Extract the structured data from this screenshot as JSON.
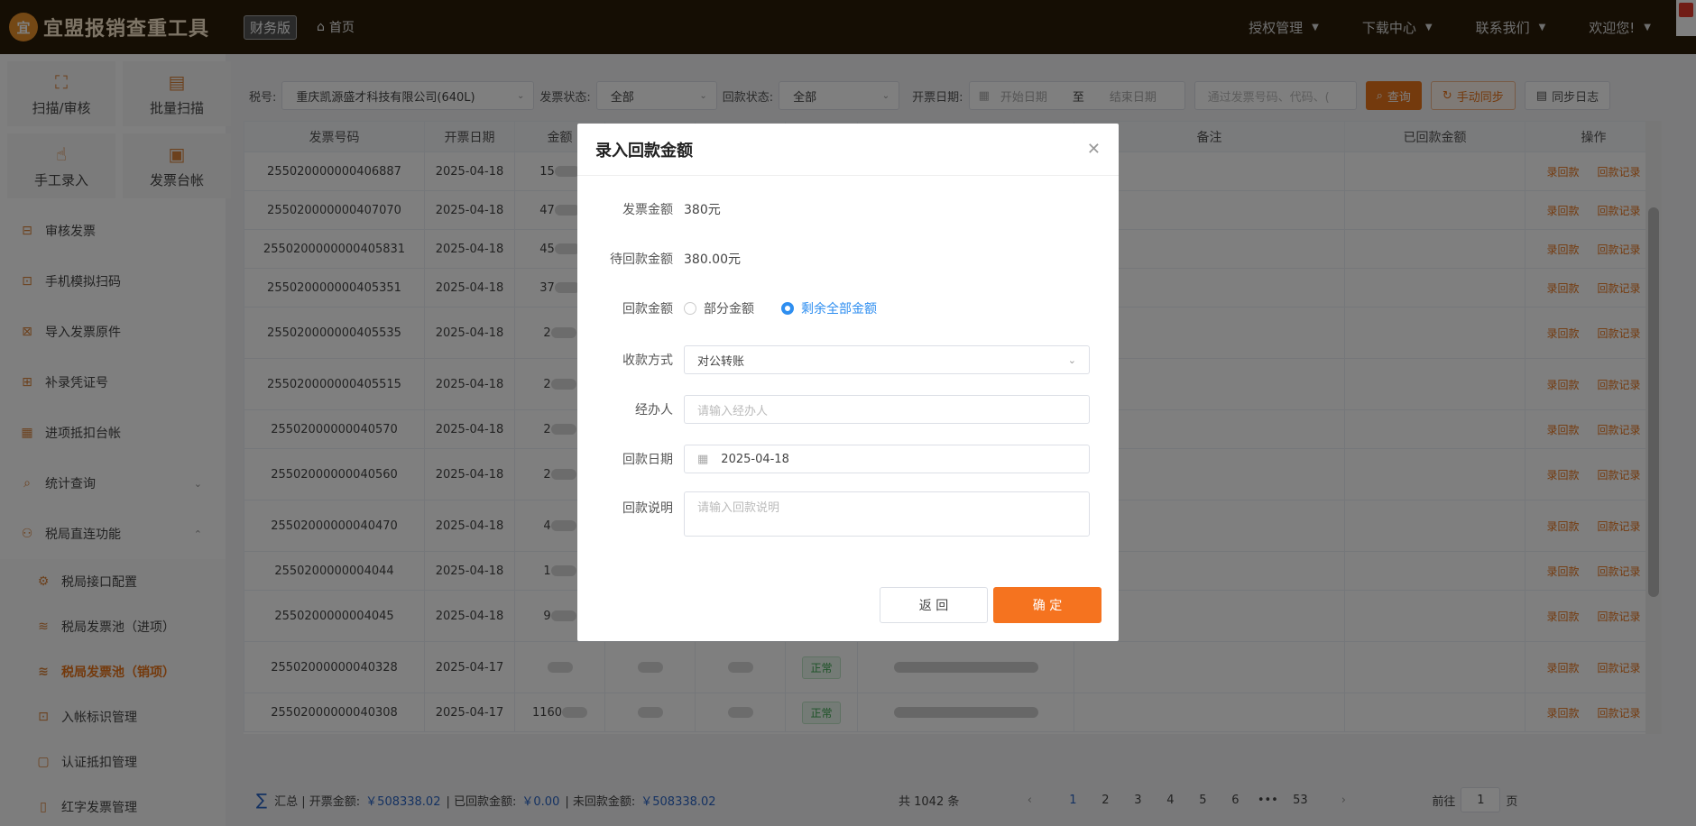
{
  "topbar": {
    "logo_mark": "宜",
    "app_title": "宜盟报销查重工具",
    "edition": "财务版",
    "home": "首页",
    "menus": [
      "授权管理",
      "下载中心",
      "联系我们",
      "欢迎您!"
    ]
  },
  "sidebar": {
    "quick": [
      {
        "label": "扫描/审核",
        "icon": "scan-icon"
      },
      {
        "label": "批量扫描",
        "icon": "batch-scan-icon"
      },
      {
        "label": "手工录入",
        "icon": "hand-entry-icon"
      },
      {
        "label": "发票台帐",
        "icon": "ledger-icon"
      }
    ],
    "items": [
      {
        "label": "审核发票"
      },
      {
        "label": "手机模拟扫码"
      },
      {
        "label": "导入发票原件"
      },
      {
        "label": "补录凭证号"
      },
      {
        "label": "进项抵扣台帐"
      },
      {
        "label": "统计查询"
      },
      {
        "label": "税局直连功能"
      }
    ],
    "sub_items": [
      {
        "label": "税局接口配置"
      },
      {
        "label": "税局发票池（进项）"
      },
      {
        "label": "税局发票池（销项）"
      },
      {
        "label": "入帐标识管理"
      },
      {
        "label": "认证抵扣管理"
      },
      {
        "label": "红字发票管理"
      }
    ]
  },
  "filters": {
    "tax_label": "税号:",
    "tax_value": "重庆凯源盛才科技有限公司(640L)",
    "invoice_status_label": "发票状态:",
    "invoice_status_value": "全部",
    "payback_status_label": "回款状态:",
    "payback_status_value": "全部",
    "date_label": "开票日期:",
    "start_placeholder": "开始日期",
    "to": "至",
    "end_placeholder": "结束日期",
    "search_placeholder": "通过发票号码、代码、(",
    "query_btn": "查询",
    "sync_btn": "手动同步",
    "log_btn": "同步日志"
  },
  "table": {
    "headers": [
      "发票号码",
      "开票日期",
      "金额",
      "",
      "",
      "",
      "",
      "备注",
      "已回款金额",
      "操作"
    ],
    "rows": [
      {
        "no": "255020000000406887",
        "date": "2025-04-18",
        "amount": "15",
        "status": ""
      },
      {
        "no": "255020000000407070",
        "date": "2025-04-18",
        "amount": "47",
        "status": ""
      },
      {
        "no": "2550200000000405831",
        "date": "2025-04-18",
        "amount": "45",
        "status": ""
      },
      {
        "no": "255020000000405351",
        "date": "2025-04-18",
        "amount": "37",
        "status": ""
      },
      {
        "no": "255020000000405535",
        "date": "2025-04-18",
        "amount": "2",
        "status": ""
      },
      {
        "no": "255020000000405515",
        "date": "2025-04-18",
        "amount": "2",
        "status": ""
      },
      {
        "no": "25502000000040570",
        "date": "2025-04-18",
        "amount": "2",
        "status": ""
      },
      {
        "no": "25502000000040560",
        "date": "2025-04-18",
        "amount": "2",
        "status": ""
      },
      {
        "no": "25502000000040470",
        "date": "2025-04-18",
        "amount": "4",
        "status": ""
      },
      {
        "no": "2550200000004044",
        "date": "2025-04-18",
        "amount": "1",
        "status": ""
      },
      {
        "no": "2550200000004045",
        "date": "2025-04-18",
        "amount": "9",
        "status": ""
      },
      {
        "no": "25502000000040328",
        "date": "2025-04-17",
        "amount": "",
        "status": "正常"
      },
      {
        "no": "25502000000040308",
        "date": "2025-04-17",
        "amount": "1160",
        "status": "正常"
      }
    ],
    "op_payback": "录回款",
    "op_record": "回款记录"
  },
  "footer": {
    "summary_prefix": "汇总 | 开票金额:",
    "invoice_total": "￥508338.02",
    "paid_label": "| 已回款金额:",
    "paid_total": "￥0.00",
    "unpaid_label": "| 未回款金额:",
    "unpaid_total": "￥508338.02",
    "total_count": "共 1042 条",
    "pages": [
      "1",
      "2",
      "3",
      "4",
      "5",
      "6",
      "•••",
      "53"
    ],
    "goto_label": "前往",
    "goto_value": "1",
    "goto_suffix": "页"
  },
  "dialog": {
    "title": "录入回款金额",
    "invoice_amount_label": "发票金额",
    "invoice_amount": "380元",
    "pending_label": "待回款金额",
    "pending_amount": "380.00元",
    "payback_amount_label": "回款金额",
    "radio_partial": "部分金额",
    "radio_all": "剩余全部金额",
    "method_label": "收款方式",
    "method_value": "对公转账",
    "handler_label": "经办人",
    "handler_placeholder": "请输入经办人",
    "date_label": "回款日期",
    "date_value": "2025-04-18",
    "note_label": "回款说明",
    "note_placeholder": "请输入回款说明",
    "back_btn": "返 回",
    "ok_btn": "确 定"
  }
}
